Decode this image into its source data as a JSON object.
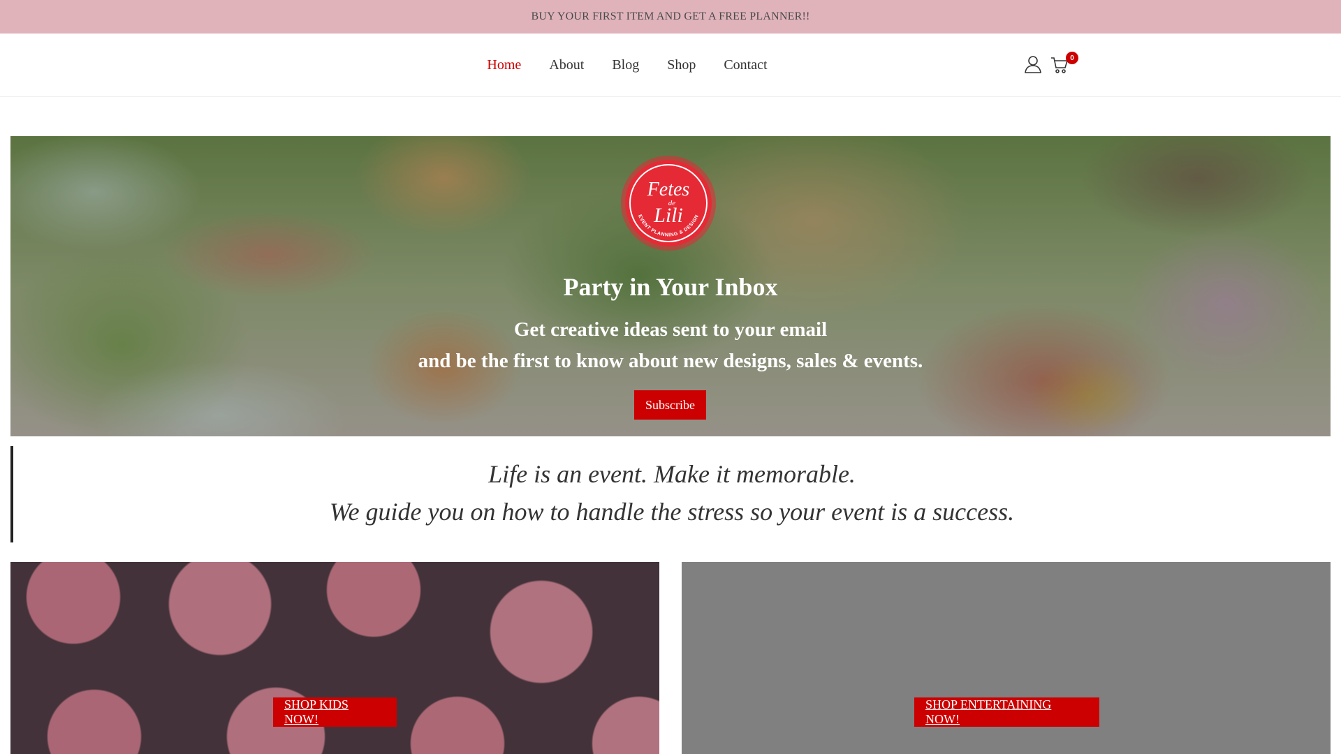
{
  "announcement": "BUY YOUR FIRST ITEM AND GET A FREE PLANNER!!",
  "nav": {
    "items": [
      {
        "label": "Home",
        "active": true
      },
      {
        "label": "About"
      },
      {
        "label": "Blog"
      },
      {
        "label": "Shop"
      },
      {
        "label": "Contact"
      }
    ],
    "cart_count": "0",
    "icons": [
      "user-icon",
      "cart-icon"
    ]
  },
  "hero": {
    "logo": {
      "line1": "Fetes",
      "line2": "de",
      "line3": "Lili",
      "ring_text": "EVENT PLANNING & DESIGN"
    },
    "title": "Party in Your Inbox",
    "line1": "Get creative ideas sent to your email",
    "line2": "and be the first to know about new designs, sales & events.",
    "subscribe_label": "Subscribe"
  },
  "quote": {
    "line1": "Life is an event. Make it memorable.",
    "line2": "We guide you on how to handle the stress so your event is a success."
  },
  "tiles": {
    "kids_label": "SHOP KIDS NOW!",
    "entertaining_label": "SHOP ENTERTAINING NOW!"
  },
  "colors": {
    "accent": "#cc0000",
    "announcement_bg": "#e0b3bb"
  }
}
